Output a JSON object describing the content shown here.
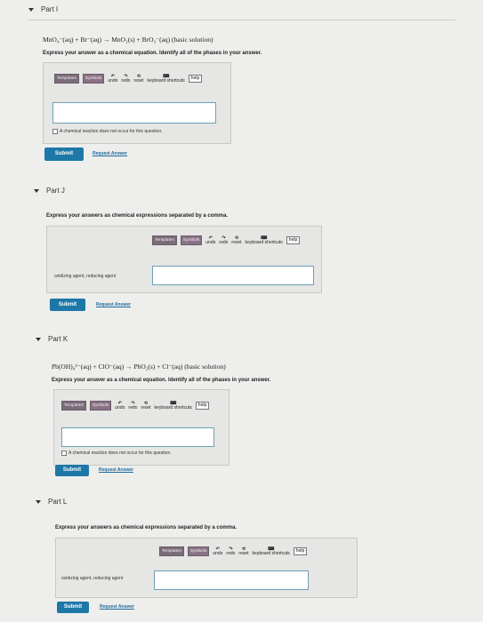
{
  "parts": [
    {
      "label": "Part I",
      "equation": "MnO₄⁻(aq) + Br⁻(aq) → MnO₂(s) + BrO₃⁻(aq) (basic solution)",
      "prompt": "Express your answer as a chemical equation. Identify all of the phases in your answer.",
      "checkbox_label": "A chemical reaction does not occur for this question."
    },
    {
      "label": "Part J",
      "prompt": "Express your answers as chemical expressions separated by a comma.",
      "field_label": "oxidizing agent, reducing agent"
    },
    {
      "label": "Part K",
      "equation": "Pb(OH)₄²⁻(aq) + ClO⁻(aq) → PbO₂(s) + Cl⁻(aq) (basic solution)",
      "prompt": "Express your answer as a chemical equation. Identify all of the phases in your answer.",
      "checkbox_label": "A chemical reaction does not occur for this question."
    },
    {
      "label": "Part L",
      "prompt": "Express your answers as chemical expressions separated by a comma.",
      "field_label": "oxidizing agent, reducing agent"
    }
  ],
  "toolbar": {
    "templates": "Templates",
    "symbols": "Symbols",
    "undo": "undo",
    "redo": "redo",
    "reset": "reset",
    "keyboard": "keyboard shortcuts",
    "help": "help"
  },
  "buttons": {
    "submit": "Submit",
    "request": "Request Answer"
  },
  "icons": {
    "collapse": "triangle-down-icon",
    "undo": "undo-icon",
    "redo": "redo-icon",
    "reset": "reset-icon",
    "keyboard": "keyboard-icon"
  },
  "colors": {
    "submit_bg": "#1d78a8",
    "link": "#1d6aa0",
    "toolbar_button": "#7b6c7a",
    "input_border": "#6f9fb7"
  }
}
